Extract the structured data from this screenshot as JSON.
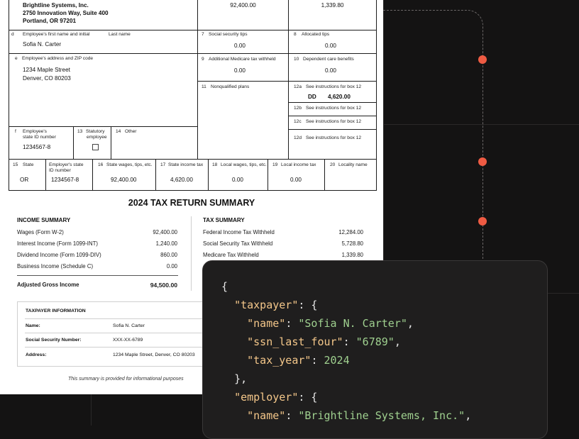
{
  "w2": {
    "employer_name": "Brightline Systems, Inc.",
    "employer_address_1": "2750 Innovation Way, Suite 400",
    "employer_address_2": "Portland, OR 97201",
    "top_box_value_a": "92,400.00",
    "top_box_value_b": "1,339.80",
    "box_d_label": "d",
    "box_d_text": "Employee's first name and initial",
    "box_d_last_label": "Last name",
    "employee_name": "Sofia N. Carter",
    "box7_num": "7",
    "box7_label": "Social security tips",
    "box7_value": "0.00",
    "box8_num": "8",
    "box8_label": "Allocated tips",
    "box8_value": "0.00",
    "box_e_label": "e",
    "box_e_text": "Employee's address and ZIP code",
    "employee_address_1": "1234 Maple Street",
    "employee_address_2": "Denver, CO 80203",
    "box9_num": "9",
    "box9_label": "Additional Medicare tax withheld",
    "box9_value": "0.00",
    "box10_num": "10",
    "box10_label": "Dependent care benefits",
    "box10_value": "0.00",
    "box11_num": "11",
    "box11_label": "Nonqualified plans",
    "box12a_num": "12a",
    "box12a_label": "See instructions for box 12",
    "box12a_code": "DD",
    "box12a_value": "4,620.00",
    "box12b_num": "12b",
    "box12b_label": "See instructions for box 12",
    "box12c_num": "12c",
    "box12c_label": "See instructions for box 12",
    "box12d_num": "12d",
    "box12d_label": "See instructions for box 12",
    "box_f_label": "f",
    "box_f_text_1": "Employee's",
    "box_f_text_2": "state ID number",
    "box_f_value": "1234567-8",
    "box13_num": "13",
    "box13_label_1": "Statutory",
    "box13_label_2": "employee",
    "box14_num": "14",
    "box14_label": "Other",
    "box15_num": "15",
    "box15_label": "State",
    "box15_value": "OR",
    "box15b_label_1": "Employer's state",
    "box15b_label_2": "ID number",
    "box15b_value": "1234567-8",
    "box16_num": "16",
    "box16_label": "State wages, tips, etc.",
    "box16_value": "92,400.00",
    "box17_num": "17",
    "box17_label": "State income tax",
    "box17_value": "4,620.00",
    "box18_num": "18",
    "box18_label": "Local wages, tips, etc.",
    "box18_value": "0.00",
    "box19_num": "19",
    "box19_label": "Local income tax",
    "box19_value": "0.00",
    "box20_num": "20",
    "box20_label": "Locality name"
  },
  "summary": {
    "title": "2024 TAX RETURN SUMMARY",
    "income_heading": "INCOME SUMMARY",
    "income_rows": [
      {
        "label": "Wages (Form W-2)",
        "amount": "92,400.00"
      },
      {
        "label": "Interest Income (Form 1099-INT)",
        "amount": "1,240.00"
      },
      {
        "label": "Dividend Income (Form 1099-DIV)",
        "amount": "860.00"
      },
      {
        "label": "Business Income (Schedule C)",
        "amount": "0.00"
      }
    ],
    "agi_label": "Adjusted Gross Income",
    "agi_amount": "94,500.00",
    "tax_heading": "TAX SUMMARY",
    "tax_rows": [
      {
        "label": "Federal Income Tax Withheld",
        "amount": "12,284.00"
      },
      {
        "label": "Social Security Tax Withheld",
        "amount": "5,728.80"
      },
      {
        "label": "Medicare Tax Withheld",
        "amount": "1,339.80"
      }
    ],
    "info_heading": "TAXPAYER INFORMATION",
    "info_rows": [
      {
        "label": "Name:",
        "value": "Sofia N. Carter"
      },
      {
        "label": "Social Security Number:",
        "value": "XXX-XX-6789"
      },
      {
        "label": "Address:",
        "value": "1234 Maple Street, Denver, CO 80203"
      }
    ],
    "footnote": "This summary is provided for informational purposes"
  },
  "code": {
    "l1": "{",
    "l2_key": "\"taxpayer\"",
    "l2_rest": ": {",
    "l3_key": "\"name\"",
    "l3_val": "\"Sofia N. Carter\"",
    "l4_key": "\"ssn_last_four\"",
    "l4_val": "\"6789\"",
    "l5_key": "\"tax_year\"",
    "l5_val": "2024",
    "l6": "},",
    "l7_key": "\"employer\"",
    "l7_rest": ": {",
    "l8_key": "\"name\"",
    "l8_val": "\"Brightline Systems, Inc.\""
  },
  "colors": {
    "background": "#141313",
    "accent_dot": "#ee5b43",
    "json_key": "#f4c78a",
    "json_value": "#9fd08f"
  }
}
